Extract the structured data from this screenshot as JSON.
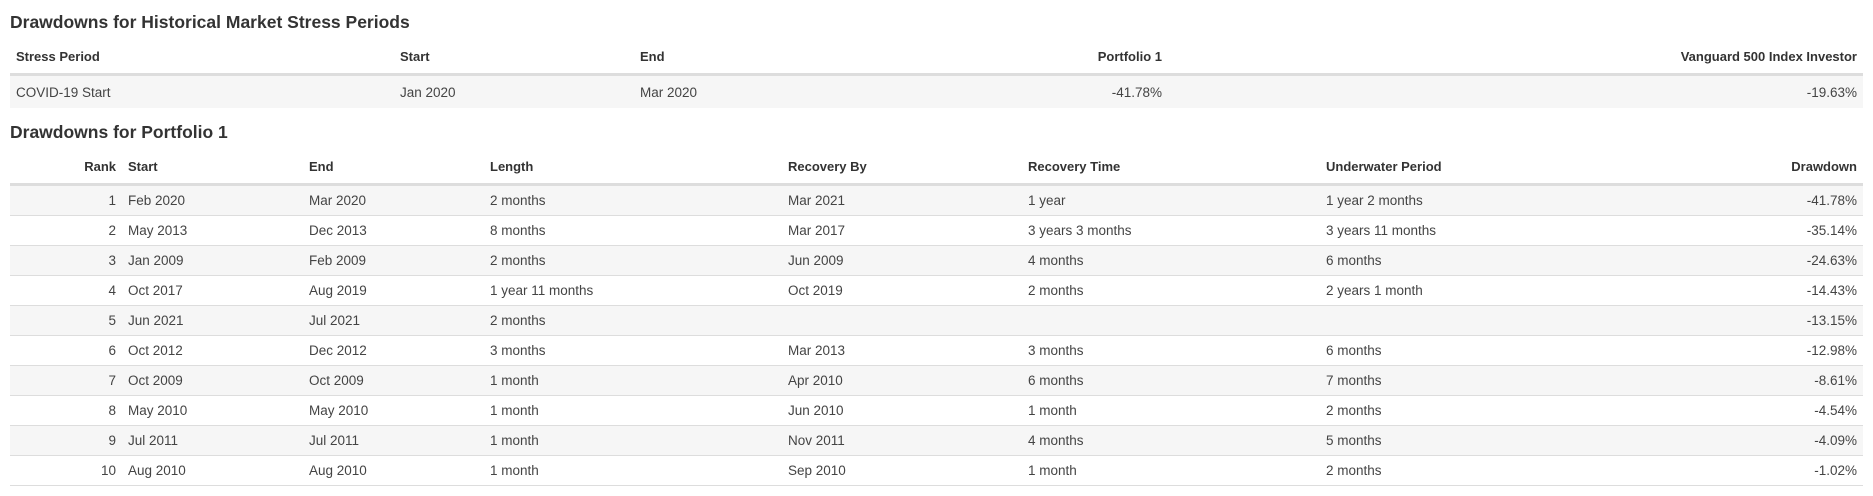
{
  "stress": {
    "title": "Drawdowns for Historical Market Stress Periods",
    "columns": [
      "Stress Period",
      "Start",
      "End",
      "Portfolio 1",
      "Vanguard 500 Index Investor"
    ],
    "rows": [
      [
        "COVID-19 Start",
        "Jan 2020",
        "Mar 2020",
        "-41.78%",
        "-19.63%"
      ]
    ]
  },
  "drawdowns": {
    "title": "Drawdowns for Portfolio 1",
    "columns": [
      "Rank",
      "Start",
      "End",
      "Length",
      "Recovery By",
      "Recovery Time",
      "Underwater Period",
      "Drawdown"
    ],
    "rows": [
      [
        "1",
        "Feb 2020",
        "Mar 2020",
        "2 months",
        "Mar 2021",
        "1 year",
        "1 year 2 months",
        "-41.78%"
      ],
      [
        "2",
        "May 2013",
        "Dec 2013",
        "8 months",
        "Mar 2017",
        "3 years 3 months",
        "3 years 11 months",
        "-35.14%"
      ],
      [
        "3",
        "Jan 2009",
        "Feb 2009",
        "2 months",
        "Jun 2009",
        "4 months",
        "6 months",
        "-24.63%"
      ],
      [
        "4",
        "Oct 2017",
        "Aug 2019",
        "1 year 11 months",
        "Oct 2019",
        "2 months",
        "2 years 1 month",
        "-14.43%"
      ],
      [
        "5",
        "Jun 2021",
        "Jul 2021",
        "2 months",
        "",
        "",
        "",
        "-13.15%"
      ],
      [
        "6",
        "Oct 2012",
        "Dec 2012",
        "3 months",
        "Mar 2013",
        "3 months",
        "6 months",
        "-12.98%"
      ],
      [
        "7",
        "Oct 2009",
        "Oct 2009",
        "1 month",
        "Apr 2010",
        "6 months",
        "7 months",
        "-8.61%"
      ],
      [
        "8",
        "May 2010",
        "May 2010",
        "1 month",
        "Jun 2010",
        "1 month",
        "2 months",
        "-4.54%"
      ],
      [
        "9",
        "Jul 2011",
        "Jul 2011",
        "1 month",
        "Nov 2011",
        "4 months",
        "5 months",
        "-4.09%"
      ],
      [
        "10",
        "Aug 2010",
        "Aug 2010",
        "1 month",
        "Sep 2010",
        "1 month",
        "2 months",
        "-1.02%"
      ]
    ]
  }
}
